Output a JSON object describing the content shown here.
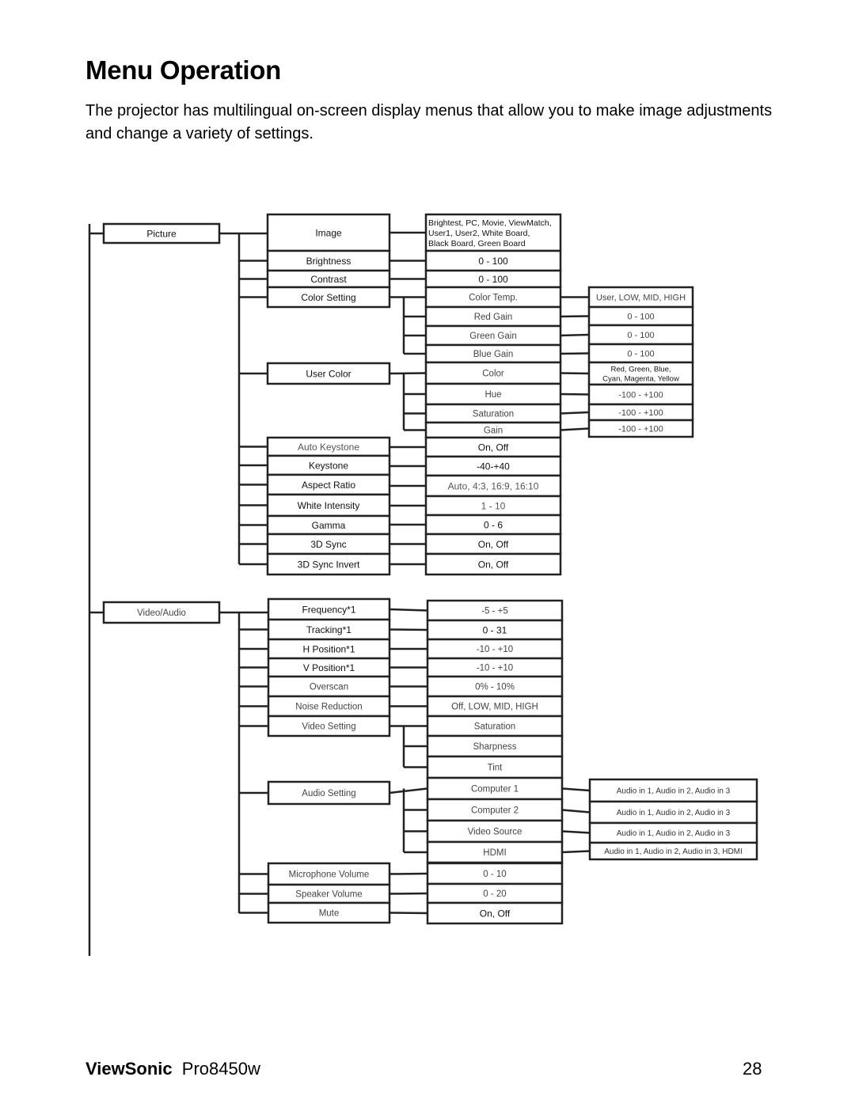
{
  "page": {
    "title": "Menu Operation",
    "intro": "The projector has multilingual on-screen display menus that allow you to make image adjustments and change a variety of settings.",
    "footer": {
      "brand": "ViewSonic",
      "model": "Pro8450w",
      "page_number": "28"
    }
  },
  "menu_tree": {
    "main_menus": [
      {
        "id": "picture",
        "label": "Picture",
        "items": [
          {
            "label": "Image",
            "option": "Brightest, PC, Movie, ViewMatch, User1, User2, White Board, Black Board, Green Board",
            "option_lines": [
              "Brightest, PC, Movie, ViewMatch,",
              "User1, User2, White Board,",
              "Black Board, Green Board"
            ]
          },
          {
            "label": "Brightness",
            "option": "0 - 100"
          },
          {
            "label": "Contrast",
            "option": "0 - 100"
          },
          {
            "label": "Color Setting",
            "sub_items": [
              {
                "label": "Color Temp.",
                "option": "User, LOW, MID, HIGH"
              },
              {
                "label": "Red Gain",
                "option": "0 - 100"
              },
              {
                "label": "Green Gain",
                "option": "0 - 100"
              },
              {
                "label": "Blue Gain",
                "option": "0 - 100"
              }
            ]
          },
          {
            "label": "User Color",
            "sub_items": [
              {
                "label": "Color",
                "option": "Red, Green, Blue, Cyan, Magenta, Yellow",
                "option_lines": [
                  "Red, Green, Blue,",
                  "Cyan, Magenta, Yellow"
                ]
              },
              {
                "label": "Hue",
                "option": "-100 - +100"
              },
              {
                "label": "Saturation",
                "option": "-100 - +100"
              },
              {
                "label": "Gain",
                "option": "-100 - +100"
              }
            ]
          },
          {
            "label": "Auto Keystone",
            "option": "On, Off"
          },
          {
            "label": "Keystone",
            "option": "-40-+40"
          },
          {
            "label": "Aspect Ratio",
            "option": "Auto, 4:3, 16:9, 16:10"
          },
          {
            "label": "White Intensity",
            "option": "1 - 10"
          },
          {
            "label": "Gamma",
            "option": "0 - 6"
          },
          {
            "label": "3D Sync",
            "option": "On, Off"
          },
          {
            "label": "3D Sync Invert",
            "option": "On, Off"
          }
        ]
      },
      {
        "id": "video-audio",
        "label": "Video/Audio",
        "items": [
          {
            "label": "Frequency*1",
            "option": "-5 - +5"
          },
          {
            "label": "Tracking*1",
            "option": "0 - 31"
          },
          {
            "label": "H Position*1",
            "option": "-10 - +10"
          },
          {
            "label": "V Position*1",
            "option": "-10 - +10"
          },
          {
            "label": "Overscan",
            "option": "0% - 10%"
          },
          {
            "label": "Noise Reduction",
            "option": "Off, LOW, MID, HIGH"
          },
          {
            "label": "Video Setting",
            "sub_items": [
              {
                "label": "Saturation"
              },
              {
                "label": "Sharpness"
              },
              {
                "label": "Tint"
              }
            ]
          },
          {
            "label": "Audio Setting",
            "sub_items": [
              {
                "label": "Computer 1",
                "option": "Audio in 1, Audio in 2, Audio in 3"
              },
              {
                "label": "Computer 2",
                "option": "Audio in 1, Audio in 2, Audio in 3"
              },
              {
                "label": "Video Source",
                "option": "Audio in 1, Audio in 2, Audio in 3"
              },
              {
                "label": "HDMI",
                "option": "Audio in 1, Audio in 2, Audio in 3, HDMI"
              }
            ]
          },
          {
            "label": "Microphone Volume",
            "option": "0 - 10"
          },
          {
            "label": "Speaker Volume",
            "option": "0 - 20"
          },
          {
            "label": "Mute",
            "option": "On, Off"
          }
        ]
      }
    ]
  }
}
